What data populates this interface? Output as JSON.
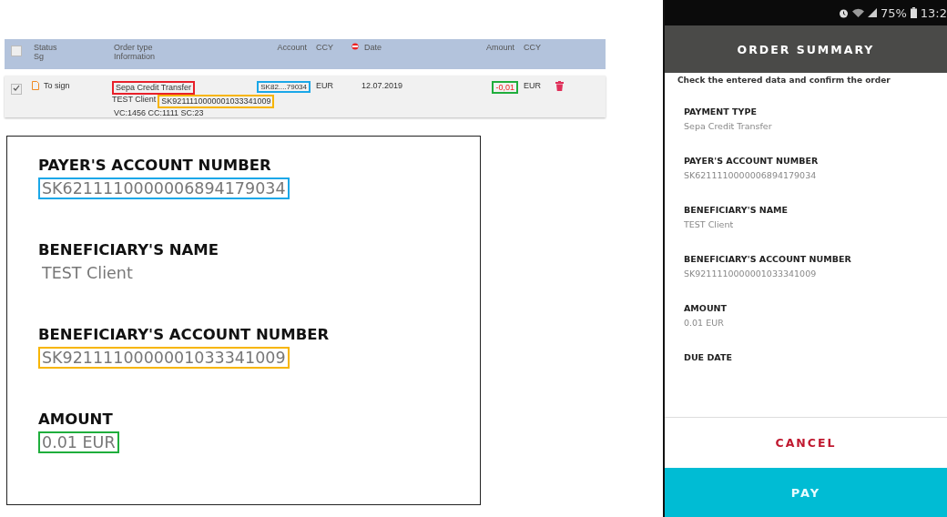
{
  "order_table": {
    "select_all_checked": false,
    "columns": [
      {
        "lines": [
          "Status",
          "Sg"
        ],
        "sorted": false
      },
      {
        "lines": [
          "Order type",
          "Information"
        ],
        "sorted": false
      },
      {
        "lines": [
          "Account"
        ],
        "sorted": false
      },
      {
        "lines": [
          "CCY"
        ],
        "sorted": false
      },
      {
        "lines": [
          "Date"
        ],
        "sorted": true
      },
      {
        "lines": [
          "Amount"
        ],
        "sorted": false
      },
      {
        "lines": [
          "CCY"
        ],
        "sorted": false
      }
    ],
    "rows": [
      {
        "checked": true,
        "status": "To sign",
        "order_type": {
          "text": "Sepa Credit Transfer",
          "color": "#e8202a"
        },
        "client": "TEST Client",
        "beneficiary_account": {
          "text": "SK9211110000001033341009",
          "color": "#f7b500"
        },
        "codes": "VC:1456 CC:1111 SC:23",
        "account": {
          "text": "SK82....79034",
          "color": "#1aa7e8"
        },
        "ccy": "EUR",
        "date": "12.07.2019",
        "amount": {
          "text": "-0,01",
          "color": "#1fae3c"
        },
        "amount_ccy": "EUR"
      }
    ]
  },
  "zoom_panel": {
    "fields": [
      {
        "label": "PAYER'S ACCOUNT NUMBER",
        "value": "SK6211110000006894179034",
        "color": "#1aa7e8"
      },
      {
        "label": "BENEFICIARY'S NAME",
        "value": "TEST Client"
      },
      {
        "label": "BENEFICIARY'S ACCOUNT NUMBER",
        "value": "SK9211110000001033341009",
        "color": "#f7b500"
      },
      {
        "label": "AMOUNT",
        "value": "0.01 EUR",
        "color": "#1fae3c"
      }
    ]
  },
  "phone": {
    "status_bar": {
      "battery": "75%",
      "time": "13:2"
    },
    "title": "ORDER SUMMARY",
    "subtitle": "Check the entered data and confirm the order",
    "fields": [
      {
        "label": "PAYMENT TYPE",
        "value": "Sepa Credit Transfer"
      },
      {
        "label": "PAYER'S ACCOUNT NUMBER",
        "value": "SK6211110000006894179034"
      },
      {
        "label": "BENEFICIARY'S NAME",
        "value": "TEST Client"
      },
      {
        "label": "BENEFICIARY'S ACCOUNT NUMBER",
        "value": "SK9211110000001033341009"
      },
      {
        "label": "AMOUNT",
        "value": "0.01 EUR"
      },
      {
        "label": "DUE DATE"
      }
    ],
    "buttons": [
      {
        "kind": "text",
        "label": "CANCEL"
      },
      {
        "kind": "filled",
        "label": "PAY"
      }
    ]
  }
}
